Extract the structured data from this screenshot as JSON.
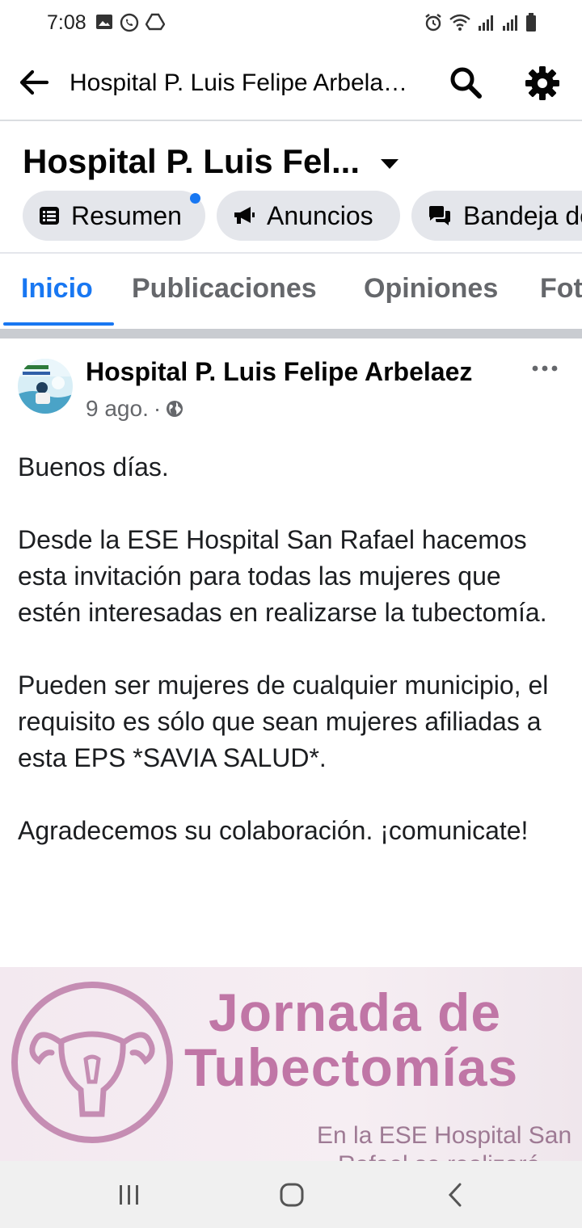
{
  "status_bar": {
    "time": "7:08"
  },
  "app_bar": {
    "title": "Hospital P. Luis Felipe Arbela…",
    "icons": [
      "back-arrow-icon",
      "search-icon",
      "gear-icon"
    ]
  },
  "page": {
    "name": "Hospital P. Luis Fel...",
    "chips": [
      {
        "label": "Resumen",
        "icon": "list-icon",
        "has_notification_dot": true
      },
      {
        "label": "Anuncios",
        "icon": "megaphone-icon"
      },
      {
        "label": "Bandeja de",
        "icon": "messages-icon"
      }
    ],
    "notification_color": "#1877f2"
  },
  "tabs": [
    {
      "label": "Inicio",
      "active": true
    },
    {
      "label": "Publicaciones"
    },
    {
      "label": "Opiniones"
    },
    {
      "label": "Fot"
    }
  ],
  "post": {
    "author": "Hospital P. Luis Felipe Arbelaez",
    "date": "9 ago.",
    "separator": "·",
    "privacy_icon": "globe-icon",
    "paragraphs": [
      "Buenos días.",
      "Desde la ESE Hospital San Rafael hacemos esta invitación para todas las mujeres que estén interesadas en realizarse la tubectomía.",
      "Pueden ser mujeres de cualquier municipio, el requisito es sólo que sean mujeres afiliadas a esta EPS *SAVIA SALUD*.",
      "Agradecemos su colaboración. ¡comunicate!"
    ],
    "image": {
      "title_line1": "Jornada de",
      "title_line2": "Tubectomías",
      "subtitle_line1": "En la ESE Hospital San",
      "subtitle_line2": "Rafael se realizará"
    }
  },
  "colors": {
    "accent": "#1877f2",
    "image_pink": "#c076a6"
  }
}
